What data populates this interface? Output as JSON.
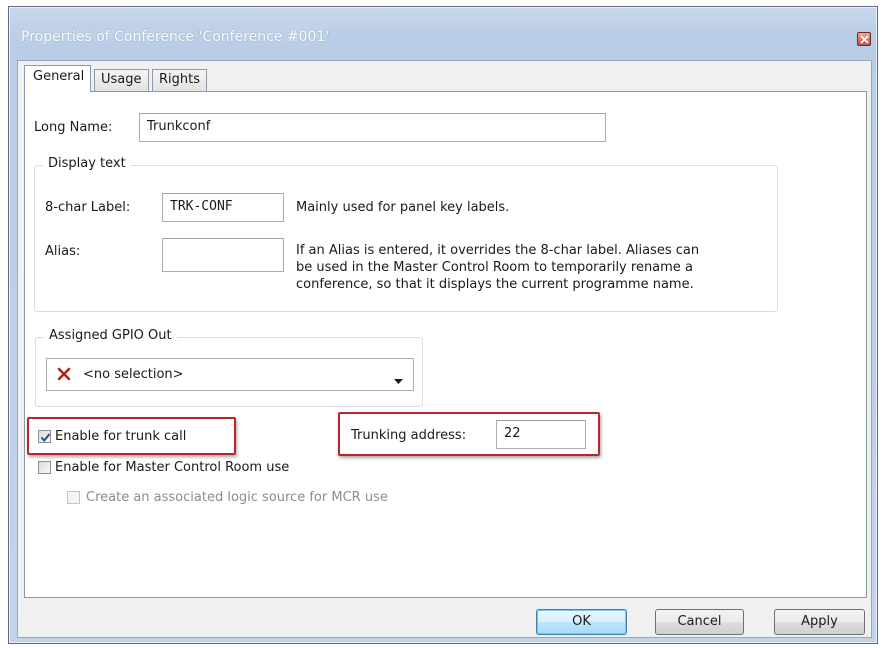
{
  "window": {
    "title": "Properties of Conference 'Conference #001'"
  },
  "tabs": [
    {
      "label": "General",
      "active": true
    },
    {
      "label": "Usage",
      "active": false
    },
    {
      "label": "Rights",
      "active": false
    }
  ],
  "general": {
    "long_name_label": "Long Name:",
    "long_name_value": "Trunkconf",
    "display_text": {
      "title": "Display text",
      "label_caption": "8-char Label:",
      "label_value": "TRK-CONF",
      "label_hint": "Mainly used for panel key labels.",
      "alias_caption": "Alias:",
      "alias_value": "",
      "alias_hint_lines": [
        "If an Alias is entered, it overrides the 8-char label. Aliases can",
        "be used in the Master Control Room to temporarily rename a",
        "conference, so that it displays the current programme name."
      ]
    },
    "gpio": {
      "title": "Assigned GPIO Out",
      "selected": "<no selection>",
      "selected_icon": "red-x-icon"
    },
    "trunk_call": {
      "label": "Enable for trunk call",
      "checked": true
    },
    "trunking_address": {
      "label": "Trunking address:",
      "value": "22"
    },
    "mcr": {
      "label": "Enable for Master Control Room use",
      "checked": false
    },
    "mcr_logic": {
      "label": "Create an associated logic source for MCR use",
      "checked": false,
      "enabled": false
    }
  },
  "buttons": {
    "ok": "OK",
    "cancel": "Cancel",
    "apply": "Apply"
  },
  "colors": {
    "highlight_box": "#b8262a",
    "red_x": "#b0221c",
    "default_button_border": "#3c7fb1"
  }
}
